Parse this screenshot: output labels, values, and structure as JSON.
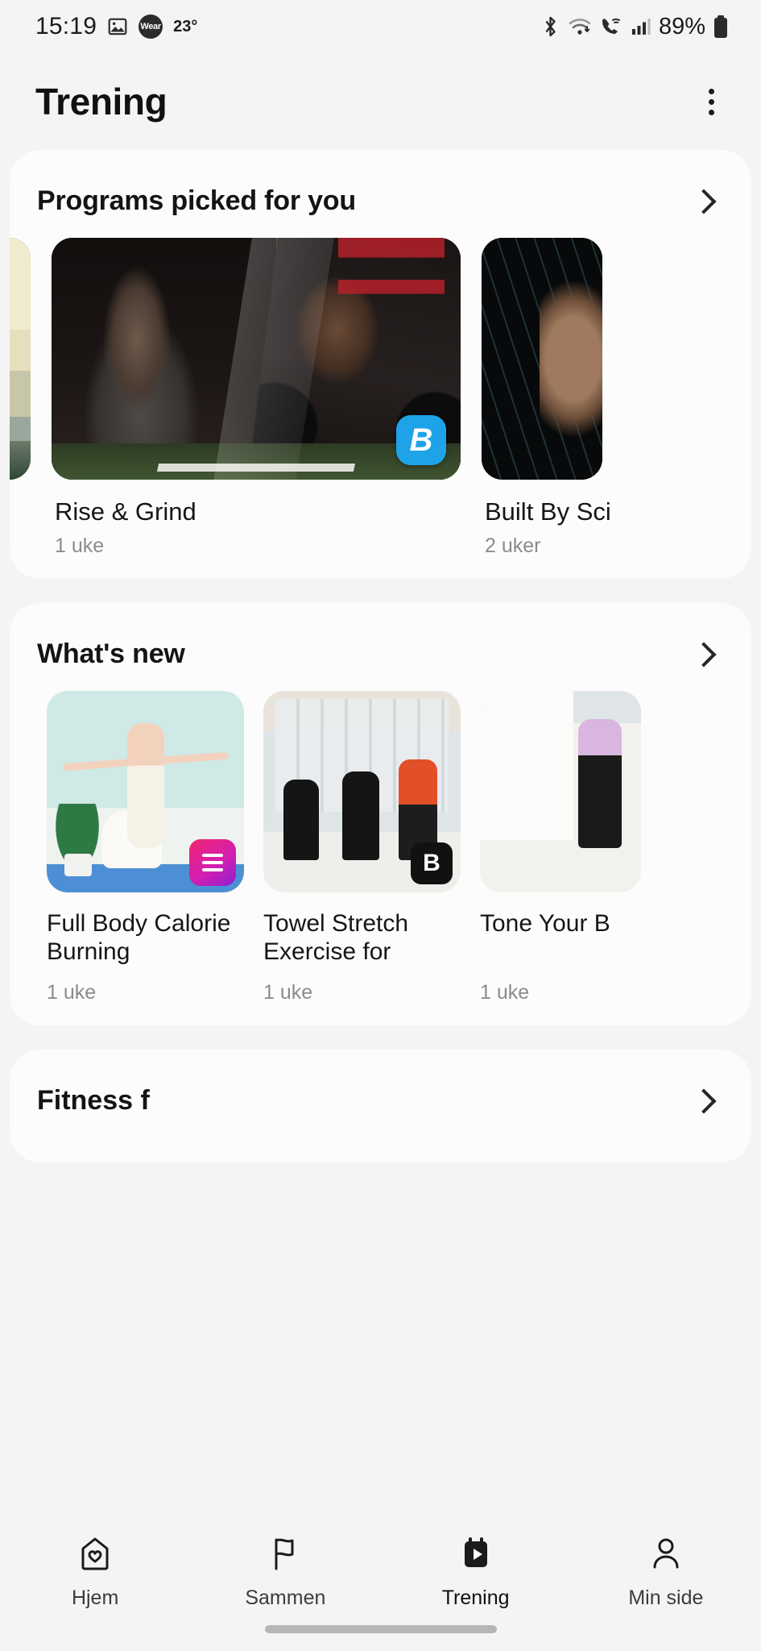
{
  "status_bar": {
    "time": "15:19",
    "image_icon": "image-icon",
    "wear_label": "Wear",
    "temperature": "23°",
    "bluetooth_icon": "bluetooth-icon",
    "wifi_icon": "wifi-icon",
    "call_icon": "call-wifi-icon",
    "signal_icon": "cellular-signal-icon",
    "battery_percent": "89%",
    "battery_icon": "battery-icon"
  },
  "app_bar": {
    "title": "Trening",
    "more_icon": "more-options-icon"
  },
  "sections": {
    "programs": {
      "title": "Programs picked for you",
      "chevron_icon": "chevron-right-icon",
      "items": [
        {
          "name": "",
          "duration": "",
          "art": "beach",
          "badge": ""
        },
        {
          "name": "Rise & Grind",
          "duration": "1 uke",
          "art": "gym",
          "badge": "bodybuilding-b-icon"
        },
        {
          "name": "Built By Sci",
          "duration": "2 uker",
          "art": "dna",
          "badge": ""
        }
      ]
    },
    "whats_new": {
      "title": "What's new",
      "chevron_icon": "chevron-right-icon",
      "items": [
        {
          "title": "Full Body Calorie Burning Exercises…",
          "duration": "1 uke",
          "art": "yoga",
          "badge": "pink-lines-icon"
        },
        {
          "title": "Towel Stretch Exercise for Post…",
          "duration": "1 uke",
          "art": "towel",
          "badge": "black-b-icon"
        },
        {
          "title": "Tone Your B",
          "duration": "1 uke",
          "art": "tone",
          "badge": ""
        }
      ]
    },
    "partial": {
      "title": "Fitness f",
      "chevron_icon": "chevron-right-icon"
    }
  },
  "bottom_nav": {
    "items": [
      {
        "label": "Hjem",
        "icon": "home-heart-icon",
        "active": false
      },
      {
        "label": "Sammen",
        "icon": "flag-icon",
        "active": false
      },
      {
        "label": "Trening",
        "icon": "workout-play-icon",
        "active": true
      },
      {
        "label": "Min side",
        "icon": "person-icon",
        "active": false
      }
    ]
  },
  "colors": {
    "background": "#f4f4f4",
    "card": "#fcfcfc",
    "text_primary": "#161616",
    "text_secondary": "#8b8b8b",
    "bodybuilding_blue": "#1fa3e8"
  }
}
